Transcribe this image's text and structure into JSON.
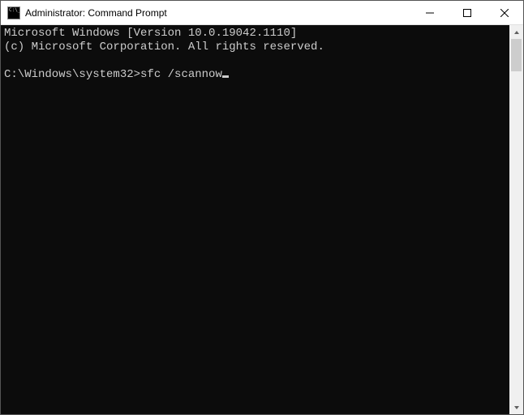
{
  "window": {
    "title": "Administrator: Command Prompt"
  },
  "terminal": {
    "line1": "Microsoft Windows [Version 10.0.19042.1110]",
    "line2": "(c) Microsoft Corporation. All rights reserved.",
    "blank": "",
    "prompt": "C:\\Windows\\system32>",
    "command": "sfc /scannow"
  }
}
